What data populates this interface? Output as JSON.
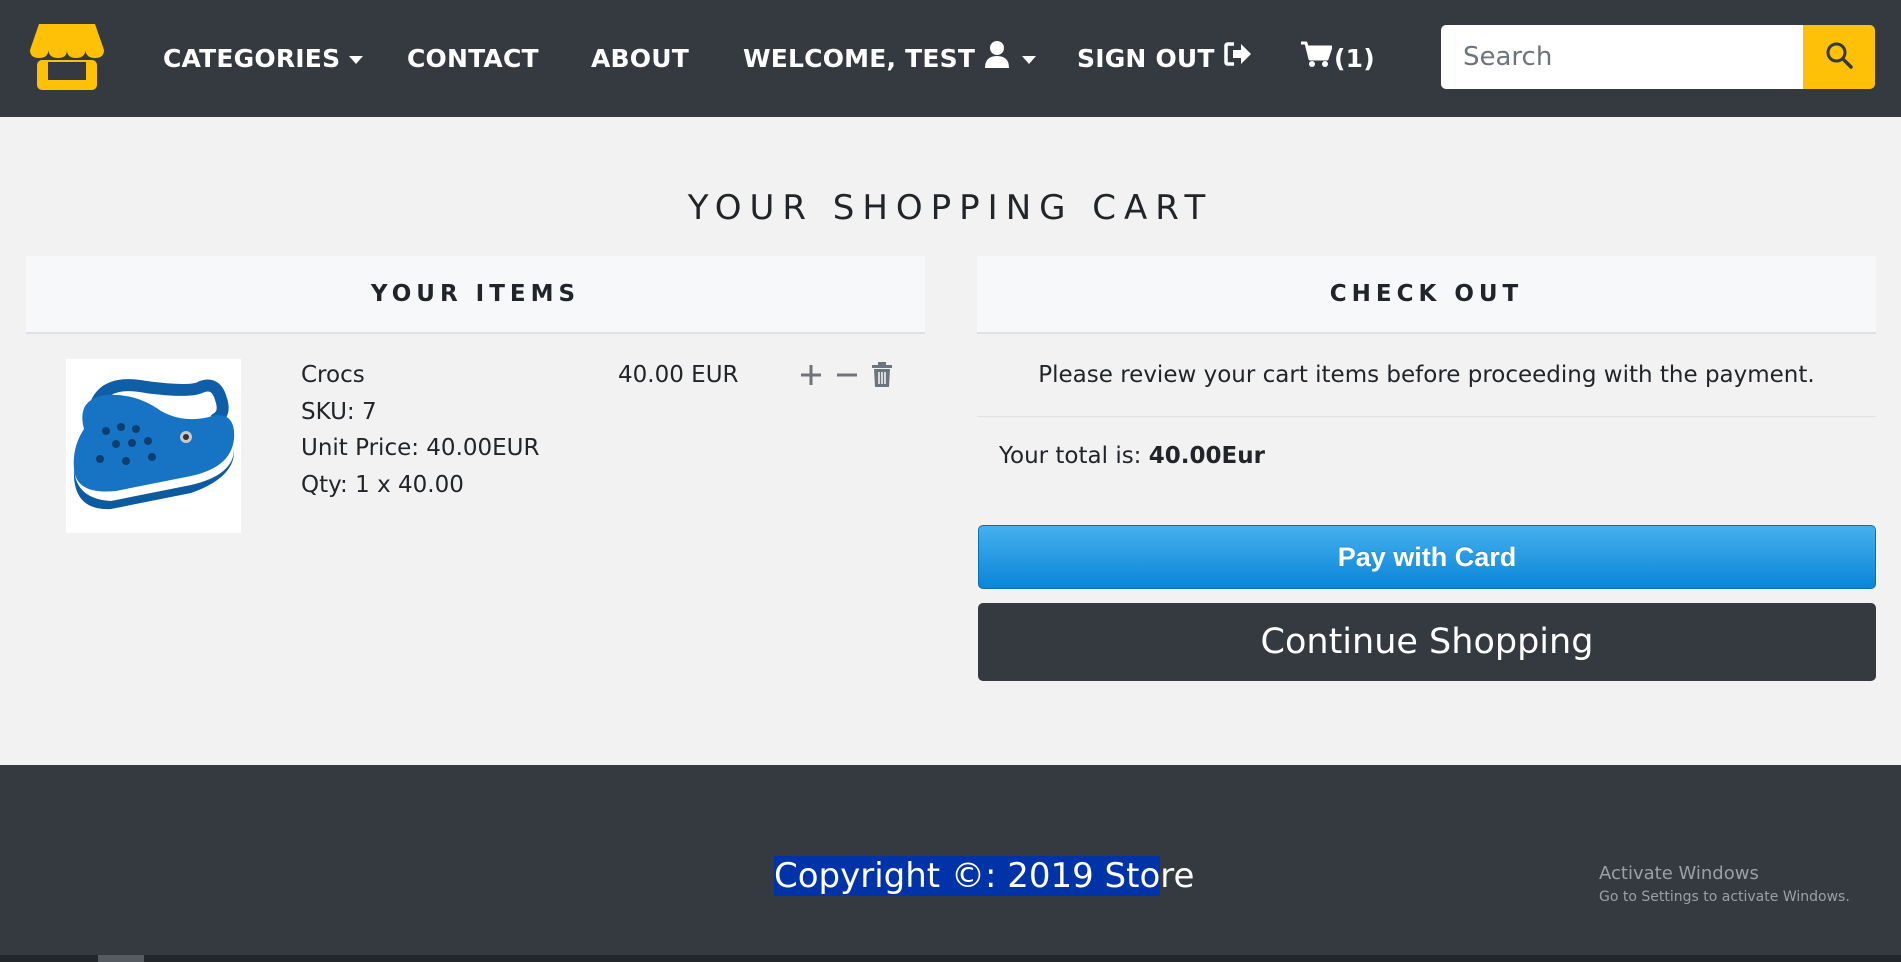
{
  "nav": {
    "categories_label": "CATEGORIES",
    "contact_label": "CONTACT",
    "about_label": "ABOUT",
    "welcome_label": "WELCOME, TEST",
    "signout_label": "SIGN OUT",
    "cart_label": "(1)",
    "search_placeholder": "Search",
    "icons": {
      "logo": "storefront-icon",
      "user": "user-icon",
      "signout": "sign-out-icon",
      "cart": "cart-icon",
      "search": "search-icon"
    }
  },
  "page": {
    "title": "YOUR SHOPPING CART"
  },
  "items_panel": {
    "header": "YOUR ITEMS",
    "items": [
      {
        "name": "Crocs",
        "sku": "SKU: 7",
        "unit_price": "Unit Price: 40.00EUR",
        "qty": "Qty: 1 x 40.00",
        "price": "40.00 EUR",
        "image": "blue-crocs-clog",
        "controls": [
          "plus-icon",
          "minus-icon",
          "trash-icon"
        ]
      }
    ]
  },
  "checkout_panel": {
    "header": "CHECK OUT",
    "note": "Please review your cart items before proceeding with the payment.",
    "total_prefix": "Your total is: ",
    "total_value": "40.00Eur",
    "pay_button": "Pay with Card",
    "continue_button": "Continue Shopping"
  },
  "footer": {
    "copyright_selected": "Copyright ©: 2019 Sto",
    "copyright_rest": "re"
  },
  "windows_watermark": {
    "title": "Activate Windows",
    "subtitle": "Go to Settings to activate Windows."
  },
  "colors": {
    "navbar_bg": "#343a40",
    "accent_yellow": "#ffc107",
    "page_bg": "#f2f2f2",
    "pay_blue": "#1a8fe0",
    "selection_blue": "#0033a8"
  }
}
